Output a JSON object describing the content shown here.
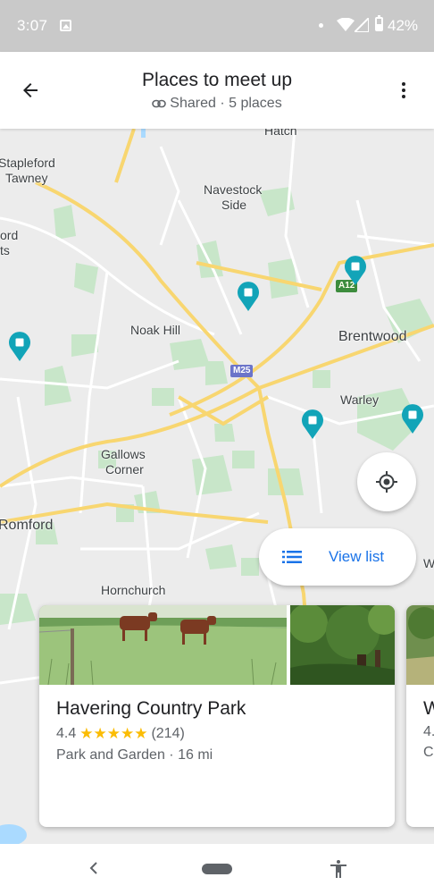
{
  "status_bar": {
    "time": "3:07",
    "battery": "42%"
  },
  "header": {
    "title": "Places to meet up",
    "subtitle": "Shared · 5 places"
  },
  "map": {
    "labels": {
      "hatch": "Hatch",
      "stapleford_1": "Stapleford",
      "stapleford_2": "Tawney",
      "navestock_1": "Navestock",
      "navestock_2": "Side",
      "ord": "ord",
      "ts": "ts",
      "noak_hill": "Noak Hill",
      "brentwood": "Brentwood",
      "warley": "Warley",
      "gallows_1": "Gallows",
      "gallows_2": "Corner",
      "romford": "Romford",
      "hornchurch": "Hornchurch",
      "w": "W"
    },
    "shields": {
      "m25": "M25",
      "a12": "A12"
    },
    "view_list_label": "View list"
  },
  "cards": [
    {
      "name": "Havering Country Park",
      "rating": "4.4",
      "stars": "★★★★★",
      "reviews": "(214)",
      "type": "Park and Garden · 16 mi"
    },
    {
      "name": "W",
      "rating": "4.",
      "type": "Co"
    }
  ],
  "colors": {
    "pin": "#12a4b8",
    "accent": "#1a73e8",
    "star": "#fbbc04",
    "road_major": "#f8d670",
    "park": "#c8e6c9"
  }
}
